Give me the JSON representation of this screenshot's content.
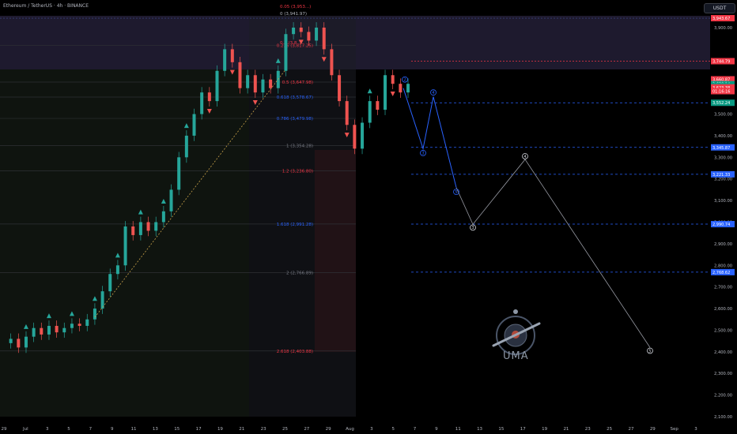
{
  "header": {
    "title": "Ethereum / TetherUS · 4h · BINANCE",
    "currency": "USDT"
  },
  "brand": "UMA",
  "chart_data": {
    "type": "candlestick",
    "ylim": [
      2100,
      4000
    ],
    "y_ticks": [
      2100,
      2200,
      2300,
      2400,
      2500,
      2600,
      2700,
      2800,
      2900,
      3000,
      3100,
      3200,
      3300,
      3400,
      3500,
      3900
    ],
    "x_ticks": [
      "29",
      "Jul",
      "3",
      "5",
      "7",
      "9",
      "11",
      "13",
      "15",
      "17",
      "19",
      "21",
      "23",
      "25",
      "27",
      "29",
      "Aug",
      "3",
      "5",
      "7",
      "9",
      "11",
      "13",
      "15",
      "17",
      "19",
      "21",
      "23",
      "25",
      "27",
      "29",
      "Sep",
      "3"
    ],
    "price_close_path": [
      [
        0,
        2440
      ],
      [
        1,
        2460
      ],
      [
        2,
        2420
      ],
      [
        3,
        2470
      ],
      [
        4,
        2510
      ],
      [
        5,
        2480
      ],
      [
        6,
        2520
      ],
      [
        7,
        2490
      ],
      [
        8,
        2510
      ],
      [
        9,
        2530
      ],
      [
        10,
        2520
      ],
      [
        11,
        2550
      ],
      [
        12,
        2600
      ],
      [
        13,
        2680
      ],
      [
        14,
        2760
      ],
      [
        15,
        2800
      ],
      [
        16,
        2980
      ],
      [
        17,
        2940
      ],
      [
        18,
        3000
      ],
      [
        19,
        2960
      ],
      [
        20,
        3000
      ],
      [
        21,
        3050
      ],
      [
        22,
        3150
      ],
      [
        23,
        3300
      ],
      [
        24,
        3400
      ],
      [
        25,
        3500
      ],
      [
        26,
        3600
      ],
      [
        27,
        3560
      ],
      [
        28,
        3700
      ],
      [
        29,
        3800
      ],
      [
        30,
        3740
      ],
      [
        31,
        3620
      ],
      [
        32,
        3680
      ],
      [
        33,
        3600
      ],
      [
        34,
        3660
      ],
      [
        35,
        3620
      ],
      [
        36,
        3700
      ],
      [
        37,
        3870
      ],
      [
        38,
        3900
      ],
      [
        39,
        3880
      ],
      [
        40,
        3840
      ],
      [
        41,
        3900
      ],
      [
        42,
        3800
      ],
      [
        43,
        3680
      ],
      [
        44,
        3560
      ],
      [
        45,
        3450
      ],
      [
        46,
        3340
      ],
      [
        47,
        3460
      ],
      [
        48,
        3560
      ],
      [
        49,
        3520
      ],
      [
        50,
        3680
      ],
      [
        51,
        3640
      ],
      [
        52,
        3600
      ],
      [
        53,
        3640
      ]
    ],
    "fib_levels": [
      {
        "label": "0.236 (3,817.25)",
        "value": 3817.25,
        "color": "#f23645"
      },
      {
        "label": "0.5 (3,647.98)",
        "value": 3647.98,
        "color": "#f23645"
      },
      {
        "label": "0.618 (3,578.67)",
        "value": 3578.67,
        "color": "#2962ff"
      },
      {
        "label": "0.786 (3,479.98)",
        "value": 3479.98,
        "color": "#2962ff"
      },
      {
        "label": "1 (3,354.28)",
        "value": 3354.28,
        "color": "#787b86"
      },
      {
        "label": "1.2 (3,236.80)",
        "value": 3236.8,
        "color": "#f23645"
      },
      {
        "label": "1.618 (2,991.28)",
        "value": 2991.28,
        "color": "#2962ff"
      },
      {
        "label": "2 (2,766.89)",
        "value": 2766.89,
        "color": "#787b86"
      },
      {
        "label": "2.618 (2,403.88)",
        "value": 2403.88,
        "color": "#f23645"
      }
    ],
    "fib_top_labels": [
      "0.05 (3,953...)",
      "0 (3,941.97)",
      "0.2 (3,8..)"
    ],
    "horizontal_levels": [
      3552.24,
      3345.87,
      3221.33,
      2990.74,
      2768.62
    ],
    "price_tags": [
      {
        "text": "3,943.67",
        "value": 3943.67,
        "color": "#f23645"
      },
      {
        "text": "3,744.79",
        "value": 3744.79,
        "color": "#f23645"
      },
      {
        "text": "3,660.87",
        "value": 3660.87,
        "color": "#f23645"
      },
      {
        "text": "3,638.14",
        "value": 3638.14,
        "color": "#089981"
      },
      {
        "text": "3,628.83",
        "value": 3628.83,
        "color": "#089981"
      },
      {
        "text": "3,623.38",
        "value": 3623.38,
        "color": "#f23645"
      },
      {
        "text": "01:16:16",
        "value": 3606,
        "color": "#f23645"
      },
      {
        "text": "3,552.24",
        "value": 3552.24,
        "color": "#089981"
      },
      {
        "text": "3,345.87",
        "value": 3345.87,
        "color": "#2962ff"
      },
      {
        "text": "3,221.33",
        "value": 3221.33,
        "color": "#2962ff"
      },
      {
        "text": "2,990.74",
        "value": 2990.74,
        "color": "#2962ff"
      },
      {
        "text": "2,768.62",
        "value": 2768.62,
        "color": "#2962ff"
      }
    ],
    "wave_labels_blue": [
      "4",
      "3",
      "5",
      "2"
    ],
    "wave_labels_white": [
      "3",
      "4",
      "5"
    ],
    "colors": {
      "up": "#26a69a",
      "down": "#ef5350",
      "projection_blue": "#2962ff",
      "projection_white": "#9598a1",
      "background": "#000000"
    }
  }
}
